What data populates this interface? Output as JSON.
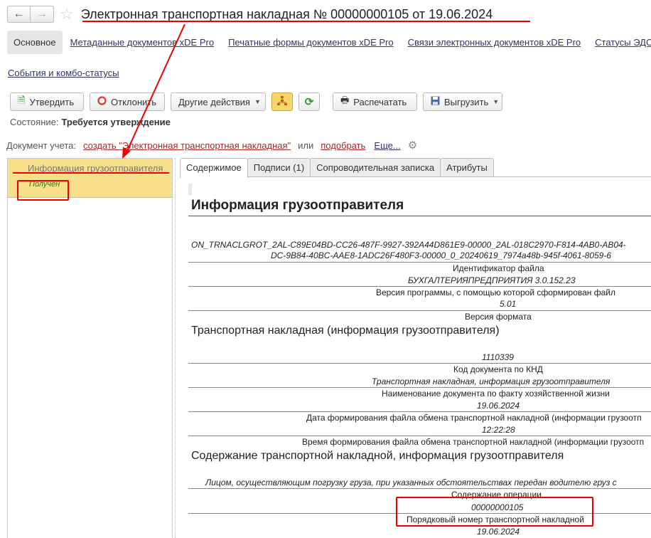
{
  "title": "Электронная транспортная накладная № 00000000105 от 19.06.2024",
  "nav": {
    "back": "←",
    "forward": "→",
    "star": "☆"
  },
  "section_tabs": [
    "Основное",
    "Метаданные документов xDE Pro",
    "Печатные формы документов xDE Pro",
    "Связи электронных документов xDE Pro",
    "Статусы ЭДО"
  ],
  "events_link": "События и комбо-статусы",
  "toolbar": {
    "approve": "Утвердить",
    "reject": "Отклонить",
    "other_actions": "Другие действия",
    "print": "Распечатать",
    "export": "Выгрузить"
  },
  "status": {
    "label": "Состояние:",
    "value": "Требуется утверждение"
  },
  "doc_line": {
    "label": "Документ учета:",
    "create_link": "создать \"Электронная транспортная накладная\"",
    "or": "или",
    "pick_link": "подобрать",
    "more_link": "Еще..."
  },
  "left_item": {
    "name": "Информация грузоотправителя",
    "status": "Получен"
  },
  "content_tabs": [
    "Содержимое",
    "Подписи (1)",
    "Сопроводительная записка",
    "Атрибуты"
  ],
  "content": {
    "heading": "Информация грузоотправителя",
    "file_id_line1": "ON_TRNACLGROT_2AL-C89E04BD-CC26-487F-9927-392A44D861E9-00000_2AL-018C2970-F814-4AB0-AB04-",
    "file_id_line2": "DC-9B84-40BC-AAE8-1ADC26F480F3-00000_0_20240619_7974a48b-945f-4061-8059-6",
    "file_id_label": "Идентификатор файла",
    "program_value": "БУХГАЛТЕРИЯПРЕДПРИЯТИЯ 3.0.152.23",
    "program_label": "Версия программы, с помощью которой сформирован файл",
    "format_value": "5.01",
    "format_label": "Версия формата",
    "doc_title": "Транспортная накладная (информация грузоотправителя)",
    "knd_value": "1110339",
    "knd_label": "Код документа по КНД",
    "docname_value": "Транспортная накладная, информация грузоотправителя",
    "docname_label": "Наименование документа по факту хозяйственной жизни",
    "date_value": "19.06.2024",
    "date_label": "Дата формирования файла обмена транспортной накладной (информации грузоотп",
    "time_value": "12:22:28",
    "time_label": "Время формирования файла обмена транспортной накладной (информации грузоотп",
    "section_title": "Содержание транспортной накладной, информация грузоотправителя",
    "operation_value": "Лицом, осуществляющим погрузку груза, при указанных обстоятельствах передан водителю груз с",
    "operation_label": "Содержание операции",
    "number_value": "00000000105",
    "number_label": "Порядковый номер транспортной накладной",
    "number_date": "19.06.2024"
  }
}
